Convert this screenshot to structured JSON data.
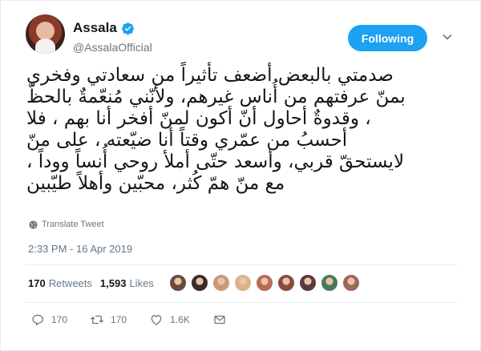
{
  "author": {
    "display_name": "Assala",
    "handle": "@AssalaOfficial",
    "verified": true
  },
  "follow_button": {
    "label": "Following"
  },
  "tweet": {
    "text": "صدمتي بالبعض أضعف تأثيراً من سعادتي وفخري\nبمنّ عرفتهم من أُناس غيرهم، ولأنّني مُنعّمةٌ بالحظّ\n، وقدوةٌ أحاول أنّ أكون لمنّ أفخر أنا بهم ، فلا\nأحسبُ من عمّري وقتاً أنا ضيّعته ، على منّ\nلايستحقّ قربي، وأسعد حتّى أملأ روحي أُنساً ووداً ،\nمع منّ همّ كُثر، محبّين وأهلاً طيّبين",
    "translate_label": "Translate Tweet",
    "timestamp": "2:33 PM - 16 Apr 2019"
  },
  "stats": {
    "retweets_count": "170",
    "retweets_label": "Retweets",
    "likes_count": "1,593",
    "likes_label": "Likes"
  },
  "likers": [
    {
      "color": "#6b4b3e"
    },
    {
      "color": "#3a2a2a"
    },
    {
      "color": "#c79a7a"
    },
    {
      "color": "#d8b48a"
    },
    {
      "color": "#b86a55"
    },
    {
      "color": "#8c4a3a"
    },
    {
      "color": "#5a3a3a"
    },
    {
      "color": "#4a7a5a"
    },
    {
      "color": "#a0685a"
    }
  ],
  "actions": {
    "replies": "170",
    "retweets": "170",
    "likes": "1.6K"
  },
  "colors": {
    "accent": "#1da1f2",
    "text": "#14171a",
    "muted": "#657786"
  }
}
